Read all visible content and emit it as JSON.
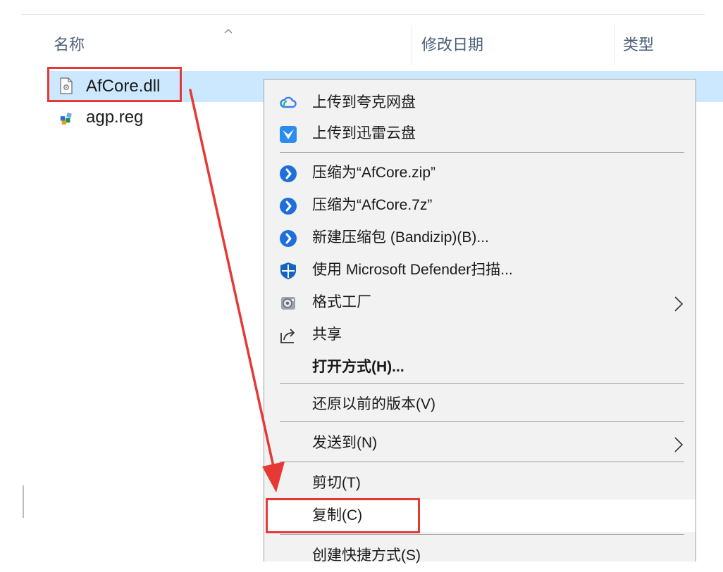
{
  "columns": {
    "name": "名称",
    "modified": "修改日期",
    "type": "类型"
  },
  "files": [
    {
      "name": "AfCore.dll",
      "icon": "dll-file-icon"
    },
    {
      "name": "agp.reg",
      "icon": "registry-file-icon"
    }
  ],
  "context_menu": {
    "upload_quark": "上传到夸克网盘",
    "upload_xunlei": "上传到迅雷云盘",
    "compress_zip": "压缩为“AfCore.zip”",
    "compress_7z": "压缩为“AfCore.7z”",
    "new_archive": "新建压缩包 (Bandizip)(B)...",
    "defender_scan": "使用 Microsoft Defender扫描...",
    "format_factory": "格式工厂",
    "share": "共享",
    "open_with": "打开方式(H)...",
    "restore_versions": "还原以前的版本(V)",
    "send_to": "发送到(N)",
    "cut": "剪切(T)",
    "copy": "复制(C)",
    "create_shortcut": "创建快捷方式(S)"
  },
  "colors": {
    "selection": "#cce8ff",
    "annotation_red": "#e53935",
    "bandizip_blue": "#1e6fd9",
    "defender_blue": "#1565c0",
    "quark_blue": "#3b7df0",
    "xunlei_blue": "#2b8cf0"
  }
}
